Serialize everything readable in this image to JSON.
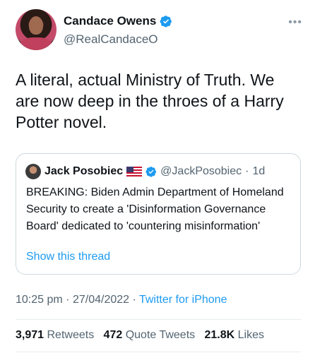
{
  "author": {
    "display_name": "Candace Owens",
    "handle": "@RealCandaceO"
  },
  "tweet": {
    "text": "A literal, actual Ministry of Truth. We are now deep in the throes of a Harry Potter novel."
  },
  "quoted_tweet": {
    "display_name": "Jack Posobiec",
    "handle": "@JackPosobiec",
    "time": "1d",
    "text": "BREAKING: Biden Admin Department of Homeland Security to create a 'Disinformation Governance Board' dedicated to 'countering misinformation'",
    "show_thread": "Show this thread"
  },
  "meta": {
    "time": "10:25 pm",
    "date": "27/04/2022",
    "source": "Twitter for iPhone"
  },
  "stats": {
    "retweets_count": "3,971",
    "retweets_label": "Retweets",
    "quotes_count": "472",
    "quotes_label": "Quote Tweets",
    "likes_count": "21.8K",
    "likes_label": "Likes"
  },
  "icons": {
    "verified": "verified-badge-icon",
    "flag": "us-flag-icon",
    "more": "more-options-icon"
  },
  "colors": {
    "link": "#1d9bf0",
    "secondary_text": "#536471",
    "border": "#cfd9de"
  }
}
